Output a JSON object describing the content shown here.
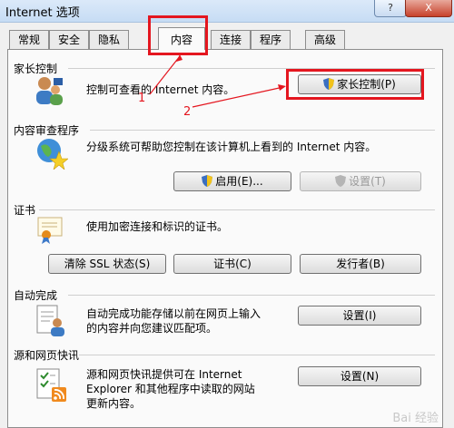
{
  "window": {
    "title": "Internet 选项",
    "help_label": "?",
    "close_label": "X"
  },
  "tabs": [
    {
      "label": "常规"
    },
    {
      "label": "安全"
    },
    {
      "label": "隐私"
    },
    {
      "label": "内容",
      "active": true
    },
    {
      "label": "连接"
    },
    {
      "label": "程序"
    },
    {
      "label": "高级"
    }
  ],
  "parental": {
    "title": "家长控制",
    "desc": "控制可查看的 Internet 内容。",
    "button": "家长控制(P)"
  },
  "advisor": {
    "title": "内容审查程序",
    "desc": "分级系统可帮助您控制在该计算机上看到的 Internet 内容。",
    "enable_button": "启用(E)...",
    "settings_button": "设置(T)"
  },
  "certs": {
    "title": "证书",
    "desc": "使用加密连接和标识的证书。",
    "clear_ssl_button": "清除 SSL 状态(S)",
    "certs_button": "证书(C)",
    "publishers_button": "发行者(B)"
  },
  "autocomplete": {
    "title": "自动完成",
    "desc_line1": "自动完成功能存储以前在网页上输入",
    "desc_line2": "的内容并向您建议匹配项。",
    "settings_button": "设置(I)"
  },
  "feeds": {
    "title": "源和网页快讯",
    "desc_line1": "源和网页快讯提供可在 Internet",
    "desc_line2": "Explorer 和其他程序中读取的网站",
    "desc_line3": "更新内容。",
    "settings_button": "设置(N)"
  },
  "annotations": {
    "step1": "1",
    "step2": "2",
    "watermark": "Bai 经验"
  },
  "colors": {
    "highlight": "#e4161f"
  }
}
